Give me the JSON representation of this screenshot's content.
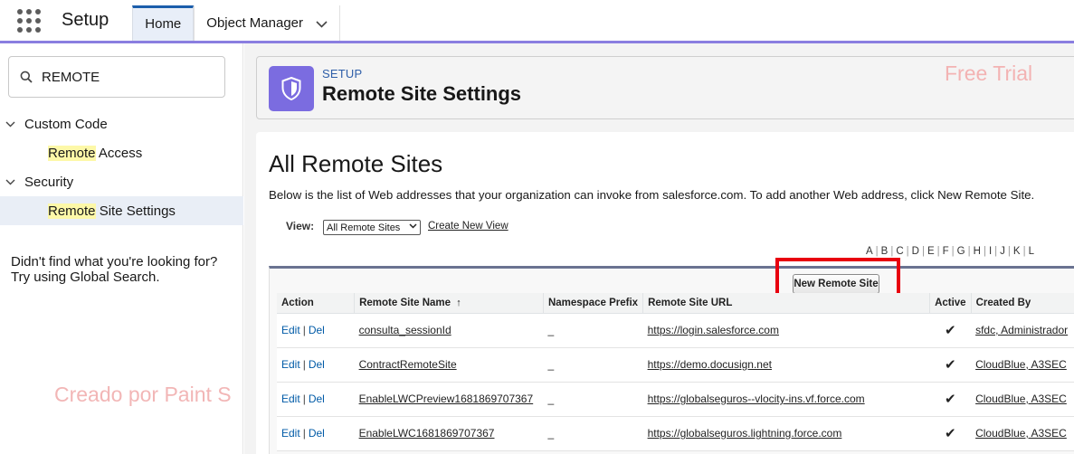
{
  "topnav": {
    "app_name": "Setup",
    "tabs": [
      {
        "label": "Home"
      },
      {
        "label": "Object Manager"
      }
    ]
  },
  "sidebar": {
    "search_value": "REMOTE",
    "groups": [
      {
        "label": "Custom Code",
        "items": [
          {
            "highlight": "Remote",
            "rest": " Access"
          }
        ]
      },
      {
        "label": "Security",
        "items": [
          {
            "highlight": "Remote",
            "rest": " Site Settings"
          }
        ]
      }
    ],
    "not_found_line1": "Didn't find what you're looking for?",
    "not_found_line2": "Try using Global Search."
  },
  "header": {
    "eyebrow": "SETUP",
    "title": "Remote Site Settings"
  },
  "watermarks": {
    "trial": "Free Trial",
    "paint": "Creado por Paint S"
  },
  "content": {
    "title": "All Remote Sites",
    "intro": "Below is the list of Web addresses that your organization can invoke from salesforce.com. To add another Web address, click New Remote Site.",
    "view_label": "View:",
    "view_selected": "All Remote Sites",
    "create_view": "Create New View",
    "alpha": [
      "A",
      "B",
      "C",
      "D",
      "E",
      "F",
      "G",
      "H",
      "I",
      "J",
      "K",
      "L"
    ],
    "new_button": "New Remote Site"
  },
  "table": {
    "headers": [
      "Action",
      "Remote Site Name",
      "Namespace Prefix",
      "Remote Site URL",
      "Active",
      "Created By"
    ],
    "sort_arrow": "↑",
    "edit": "Edit",
    "del": "Del",
    "rows": [
      {
        "name": "consulta_sessionId",
        "ns": "_",
        "url": "https://login.salesforce.com",
        "active": "✔",
        "created_by": "sfdc, Administrador"
      },
      {
        "name": "ContractRemoteSite",
        "ns": "_",
        "url": "https://demo.docusign.net",
        "active": "✔",
        "created_by": "CloudBlue, A3SEC"
      },
      {
        "name": "EnableLWCPreview1681869707367",
        "ns": "_",
        "url": "https://globalseguros--vlocity-ins.vf.force.com",
        "active": "✔",
        "created_by": "CloudBlue, A3SEC"
      },
      {
        "name": "EnableLWC1681869707367",
        "ns": "_",
        "url": "https://globalseguros.lightning.force.com",
        "active": "✔",
        "created_by": "CloudBlue, A3SEC"
      }
    ]
  }
}
